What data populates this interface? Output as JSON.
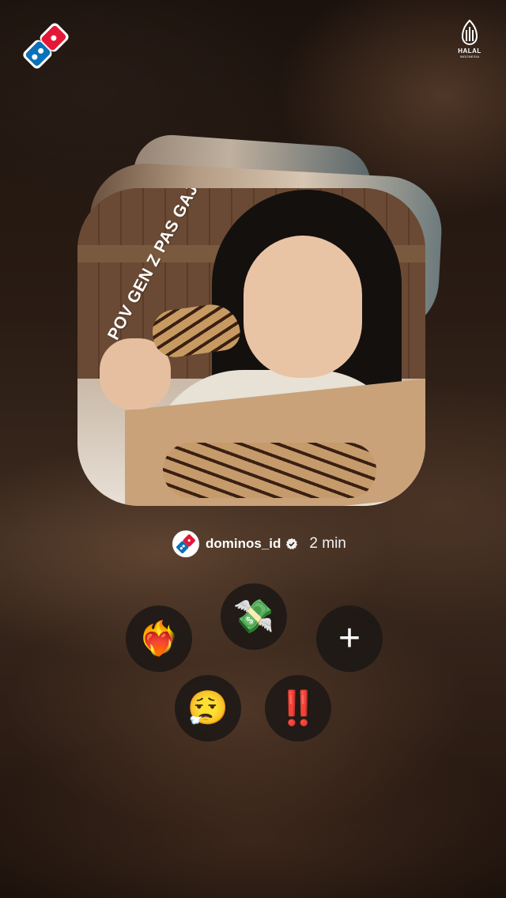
{
  "header": {
    "logo_icon": "dominos-logo-icon",
    "halal": {
      "label": "HALAL",
      "sublabel": "INDONESIA"
    }
  },
  "story": {
    "caption": "POV GEN Z PAS GAJIAN:"
  },
  "author": {
    "username": "dominos_id",
    "verified_icon": "verified-badge-icon",
    "time": "2 min"
  },
  "reactions": [
    {
      "name": "heart-on-fire",
      "emoji": "❤️‍🔥"
    },
    {
      "name": "money-with-wings",
      "emoji": "💸"
    },
    {
      "name": "add-reaction",
      "emoji": "+"
    },
    {
      "name": "relieved-face",
      "emoji": "😮‍💨"
    },
    {
      "name": "double-exclamation",
      "emoji": "‼️"
    }
  ],
  "colors": {
    "dominos_blue": "#0B70B8",
    "dominos_red": "#E31837",
    "button_bg": "#1c1816"
  }
}
